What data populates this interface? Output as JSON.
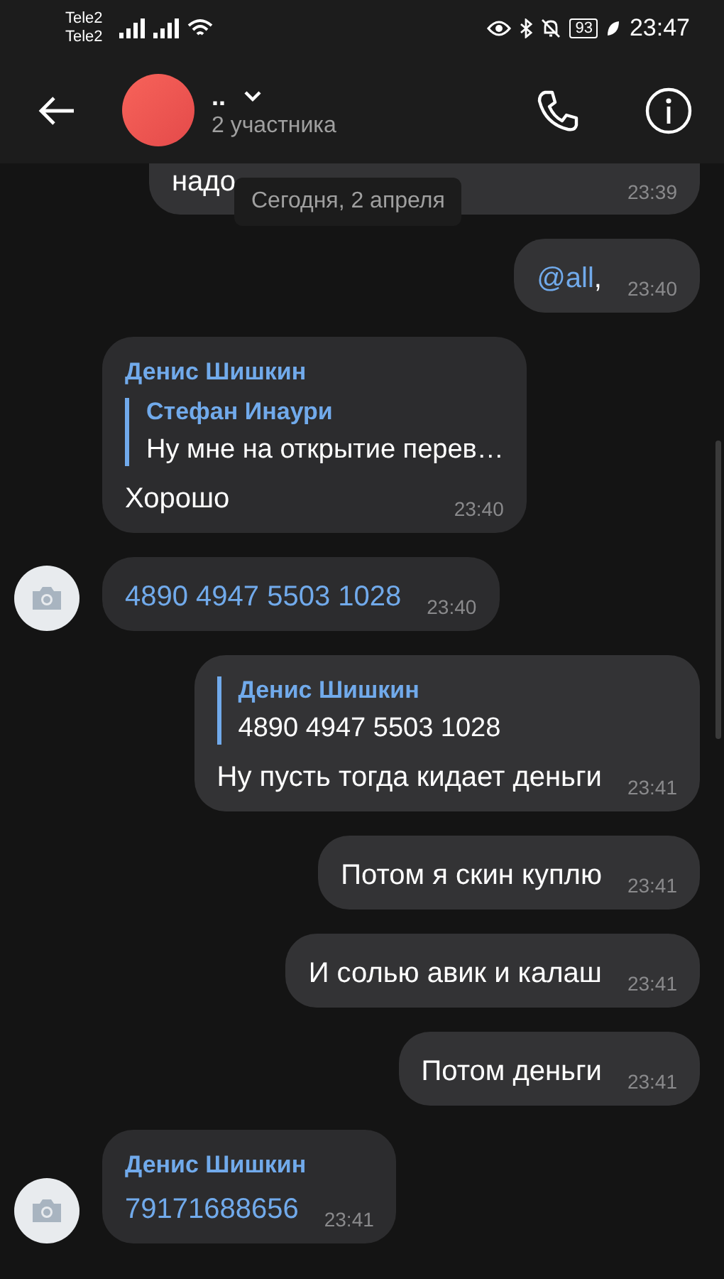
{
  "status_bar": {
    "carriers": [
      "Tele2",
      "Tele2"
    ],
    "battery": "93",
    "time": "23:47"
  },
  "header": {
    "title": "..",
    "subtitle": "2 участника"
  },
  "date_pill": "Сегодня, 2 апреля",
  "messages": [
    {
      "kind": "outgoing",
      "text": "надо",
      "time": "23:39",
      "cut": true
    },
    {
      "kind": "outgoing",
      "mention": "@all",
      "text": ",",
      "time": "23:40"
    },
    {
      "kind": "incoming",
      "sender": "Денис Шишкин",
      "reply": {
        "author": "Стефан Инаури",
        "text": "Ну мне на открытие перев…"
      },
      "text": "Хорошо",
      "time": "23:40",
      "avatar": false
    },
    {
      "kind": "incoming",
      "text": "4890 4947 5503 1028",
      "link": true,
      "time": "23:40",
      "avatar": true
    },
    {
      "kind": "outgoing",
      "reply": {
        "author": "Денис Шишкин",
        "text": "4890 4947 5503 1028"
      },
      "text": "Ну пусть тогда кидает деньги",
      "time": "23:41"
    },
    {
      "kind": "outgoing",
      "text": "Потом я скин куплю",
      "time": "23:41"
    },
    {
      "kind": "outgoing",
      "text": "И солью авик и калаш",
      "time": "23:41"
    },
    {
      "kind": "outgoing",
      "text": "Потом деньги",
      "time": "23:41"
    },
    {
      "kind": "incoming",
      "sender": "Денис Шишкин",
      "text": "79171688656",
      "link": true,
      "time": "23:41",
      "avatar": true
    }
  ]
}
